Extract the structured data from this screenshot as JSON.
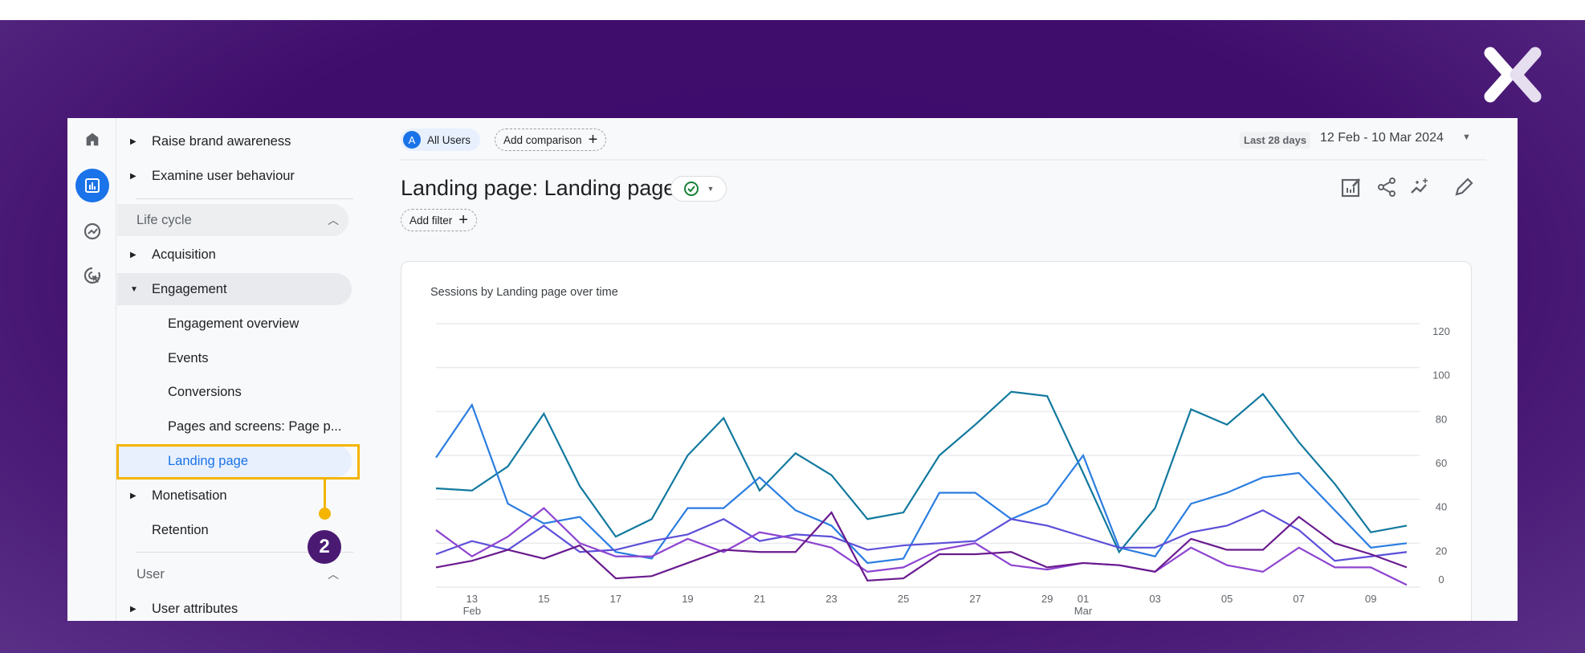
{
  "brand": {
    "logo": "X"
  },
  "rail": {
    "icons": [
      "home-icon",
      "reports-icon",
      "explore-icon",
      "advertising-icon"
    ]
  },
  "sidebar": {
    "items": [
      {
        "label": "Raise brand awareness",
        "type": "collapsed"
      },
      {
        "label": "Examine user behaviour",
        "type": "collapsed"
      },
      {
        "label": "Life cycle",
        "type": "section"
      },
      {
        "label": "Acquisition",
        "type": "collapsed"
      },
      {
        "label": "Engagement",
        "type": "expanded"
      },
      {
        "label": "Engagement overview",
        "type": "sub"
      },
      {
        "label": "Events",
        "type": "sub"
      },
      {
        "label": "Conversions",
        "type": "sub"
      },
      {
        "label": "Pages and screens: Page p...",
        "type": "sub"
      },
      {
        "label": "Landing page",
        "type": "sub",
        "selected": true
      },
      {
        "label": "Monetisation",
        "type": "collapsed"
      },
      {
        "label": "Retention",
        "type": "leaf"
      },
      {
        "label": "User",
        "type": "section"
      },
      {
        "label": "User attributes",
        "type": "collapsed"
      }
    ],
    "annotation_step": "2"
  },
  "header": {
    "segment_letter": "A",
    "segment_label": "All Users",
    "add_comparison": "Add comparison",
    "date_preset": "Last 28 days",
    "date_range": "12 Feb - 10 Mar 2024",
    "title": "Landing page: Landing page",
    "add_filter": "Add filter",
    "actions": [
      "customize-report-icon",
      "share-icon",
      "insights-icon",
      "edit-icon"
    ]
  },
  "colors": {
    "accent": "#1a73e8",
    "highlight": "#f4b400",
    "badge": "#4a1a73"
  },
  "chart_data": {
    "type": "line",
    "title": "Sessions by Landing page over time",
    "x": [
      "12 Feb",
      "13 Feb",
      "14 Feb",
      "15 Feb",
      "16 Feb",
      "17 Feb",
      "18 Feb",
      "19 Feb",
      "20 Feb",
      "21 Feb",
      "22 Feb",
      "23 Feb",
      "24 Feb",
      "25 Feb",
      "26 Feb",
      "27 Feb",
      "28 Feb",
      "29 Feb",
      "01 Mar",
      "02 Mar",
      "03 Mar",
      "04 Mar",
      "05 Mar",
      "06 Mar",
      "07 Mar",
      "08 Mar",
      "09 Mar",
      "10 Mar"
    ],
    "xticks": [
      {
        "label": "13",
        "sub": "Feb",
        "i": 1
      },
      {
        "label": "15",
        "i": 3
      },
      {
        "label": "17",
        "i": 5
      },
      {
        "label": "19",
        "i": 7
      },
      {
        "label": "21",
        "i": 9
      },
      {
        "label": "23",
        "i": 11
      },
      {
        "label": "25",
        "i": 13
      },
      {
        "label": "27",
        "i": 15
      },
      {
        "label": "29",
        "i": 17
      },
      {
        "label": "01",
        "sub": "Mar",
        "i": 18
      },
      {
        "label": "03",
        "i": 20
      },
      {
        "label": "05",
        "i": 22
      },
      {
        "label": "07",
        "i": 24
      },
      {
        "label": "09",
        "i": 26
      }
    ],
    "yticks": [
      "0",
      "20",
      "40",
      "60",
      "80",
      "100",
      "120"
    ],
    "ylim": [
      0,
      120
    ],
    "grid": true,
    "yaxis_side": "right",
    "series": [
      {
        "color": "#12799e",
        "values": [
          45,
          44,
          55,
          79,
          46,
          23,
          31,
          60,
          77,
          44,
          61,
          51,
          31,
          34,
          60,
          74,
          89,
          87,
          52,
          16,
          36,
          81,
          74,
          88,
          66,
          47,
          25,
          28
        ]
      },
      {
        "color": "#2b7de0",
        "values": [
          59,
          83,
          38,
          29,
          32,
          16,
          13,
          36,
          36,
          50,
          35,
          28,
          11,
          13,
          43,
          43,
          31,
          38,
          60,
          18,
          14,
          38,
          43,
          50,
          52,
          35,
          18,
          20
        ]
      },
      {
        "color": "#5c4fd9",
        "values": [
          15,
          21,
          17,
          28,
          16,
          17,
          21,
          24,
          31,
          21,
          24,
          23,
          17,
          19,
          20,
          21,
          31,
          28,
          23,
          18,
          18,
          25,
          28,
          35,
          26,
          12,
          14,
          16
        ]
      },
      {
        "color": "#8e44d0",
        "values": [
          26,
          14,
          23,
          36,
          20,
          14,
          14,
          22,
          16,
          25,
          22,
          18,
          7,
          9,
          17,
          20,
          10,
          8,
          11,
          10,
          7,
          18,
          10,
          7,
          18,
          9,
          9,
          1
        ]
      },
      {
        "color": "#6a1b8f",
        "values": [
          9,
          12,
          17,
          13,
          19,
          4,
          5,
          11,
          17,
          16,
          16,
          34,
          3,
          4,
          15,
          15,
          16,
          9,
          11,
          10,
          7,
          22,
          17,
          17,
          32,
          20,
          15,
          9
        ]
      }
    ]
  }
}
